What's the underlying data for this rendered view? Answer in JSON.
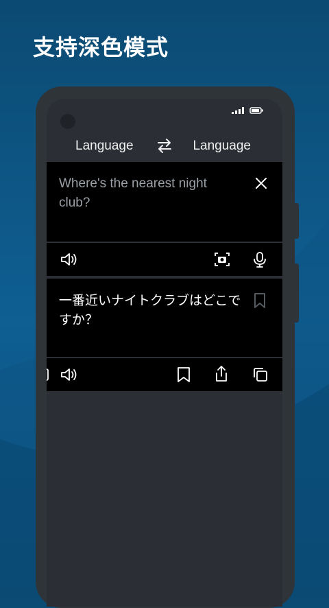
{
  "promo": {
    "title": "支持深色模式"
  },
  "translator": {
    "source_language": "Language",
    "target_language": "Language",
    "input_text": "Where's the nearest night club?",
    "output_text": "一番近いナイトクラブはどこですか？"
  },
  "colors": {
    "background": "#0f5f93",
    "phone": "#2f3439",
    "screen": "#2b2f35",
    "panel": "#000000",
    "placeholder_text": "#9aa0a6"
  },
  "icons": {
    "swap": "swap-arrows-icon",
    "close": "close-icon",
    "speaker": "speaker-icon",
    "camera": "camera-icon",
    "mic": "microphone-icon",
    "bookmark": "bookmark-icon",
    "share": "share-icon",
    "copy": "copy-icon"
  }
}
